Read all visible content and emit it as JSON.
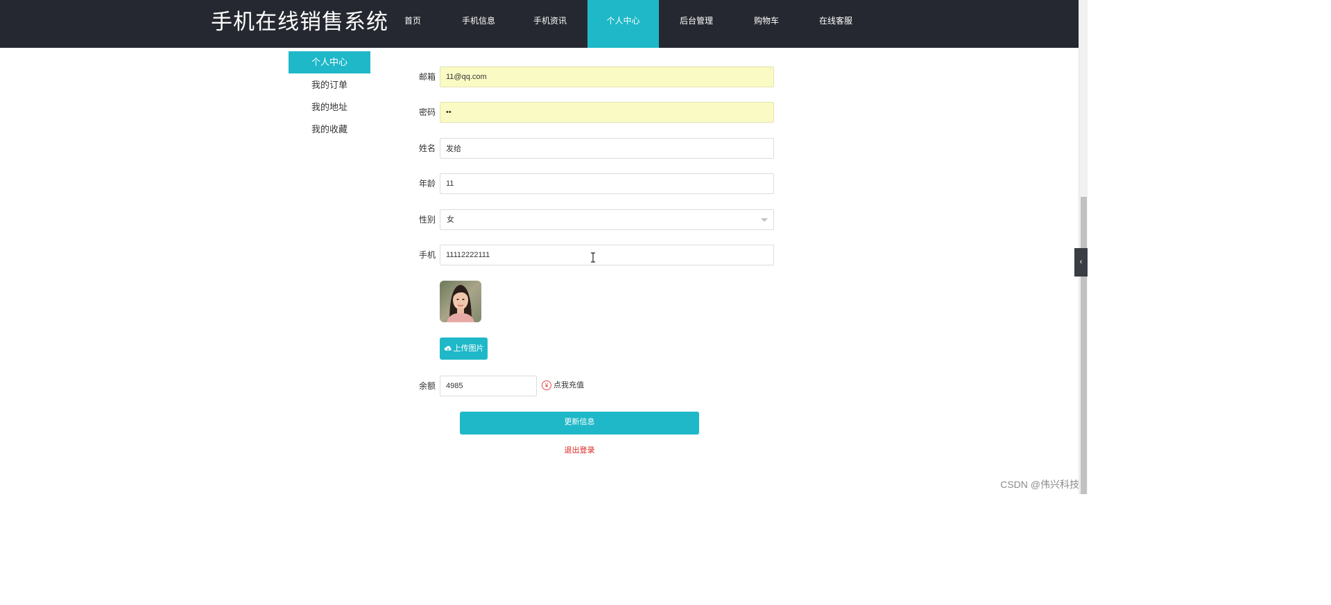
{
  "header": {
    "brand": "手机在线销售系统",
    "nav": [
      {
        "label": "首页"
      },
      {
        "label": "手机信息"
      },
      {
        "label": "手机资讯"
      },
      {
        "label": "个人中心",
        "active": true
      },
      {
        "label": "后台管理"
      },
      {
        "label": "购物车"
      },
      {
        "label": "在线客服"
      }
    ]
  },
  "sidebar": {
    "items": [
      {
        "label": "个人中心",
        "active": true
      },
      {
        "label": "我的订单"
      },
      {
        "label": "我的地址"
      },
      {
        "label": "我的收藏"
      }
    ]
  },
  "form": {
    "email": {
      "label": "邮箱",
      "value": "11@qq.com"
    },
    "password": {
      "label": "密码",
      "value": "••"
    },
    "name": {
      "label": "姓名",
      "value": "发给"
    },
    "age": {
      "label": "年龄",
      "value": "11"
    },
    "gender": {
      "label": "性别",
      "value": "女"
    },
    "phone": {
      "label": "手机",
      "value": "11112222111"
    },
    "upload_label": "上传图片",
    "balance": {
      "label": "余额",
      "value": "4985"
    },
    "recharge_label": "点我充值",
    "update_label": "更新信息",
    "logout_label": "退出登录"
  },
  "icons": {
    "upload": "cloud-upload-icon",
    "yen": "yen-icon",
    "chevron": "chevron-left-icon"
  },
  "colors": {
    "accent": "#1fb8c8",
    "navbar": "#252830",
    "danger": "#d9251d",
    "autofill": "#fafbc4"
  },
  "watermark": "CSDN @伟兴科技"
}
